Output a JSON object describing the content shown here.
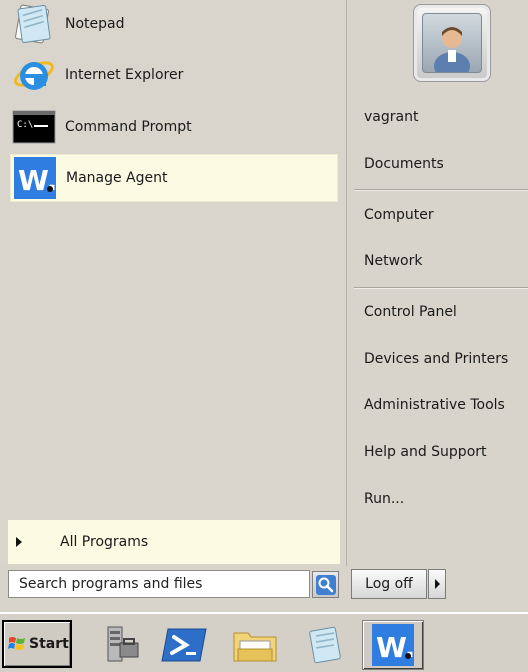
{
  "pinned_programs": [
    {
      "label": "Notepad",
      "icon": "notepad-icon"
    },
    {
      "label": "Internet Explorer",
      "icon": "internet-explorer-icon"
    },
    {
      "label": "Command Prompt",
      "icon": "command-prompt-icon",
      "icon_text": "C:\\"
    },
    {
      "label": "Manage Agent",
      "icon": "manage-agent-icon",
      "icon_text": "W."
    }
  ],
  "all_programs": {
    "label": "All Programs"
  },
  "search": {
    "placeholder": "Search programs and files"
  },
  "right_pane": {
    "user": "vagrant",
    "documents": "Documents",
    "computer": "Computer",
    "network": "Network",
    "control_panel": "Control Panel",
    "devices_printers": "Devices and Printers",
    "admin_tools": "Administrative Tools",
    "help_support": "Help and Support",
    "run": "Run..."
  },
  "shutdown": {
    "label": "Log off"
  },
  "taskbar": {
    "start_label": "Start",
    "agent_icon_text": "W."
  },
  "colors": {
    "highlight": "#fbfbe4",
    "agent_blue": "#2f7de1",
    "powershell_blue": "#2d6ec9"
  }
}
